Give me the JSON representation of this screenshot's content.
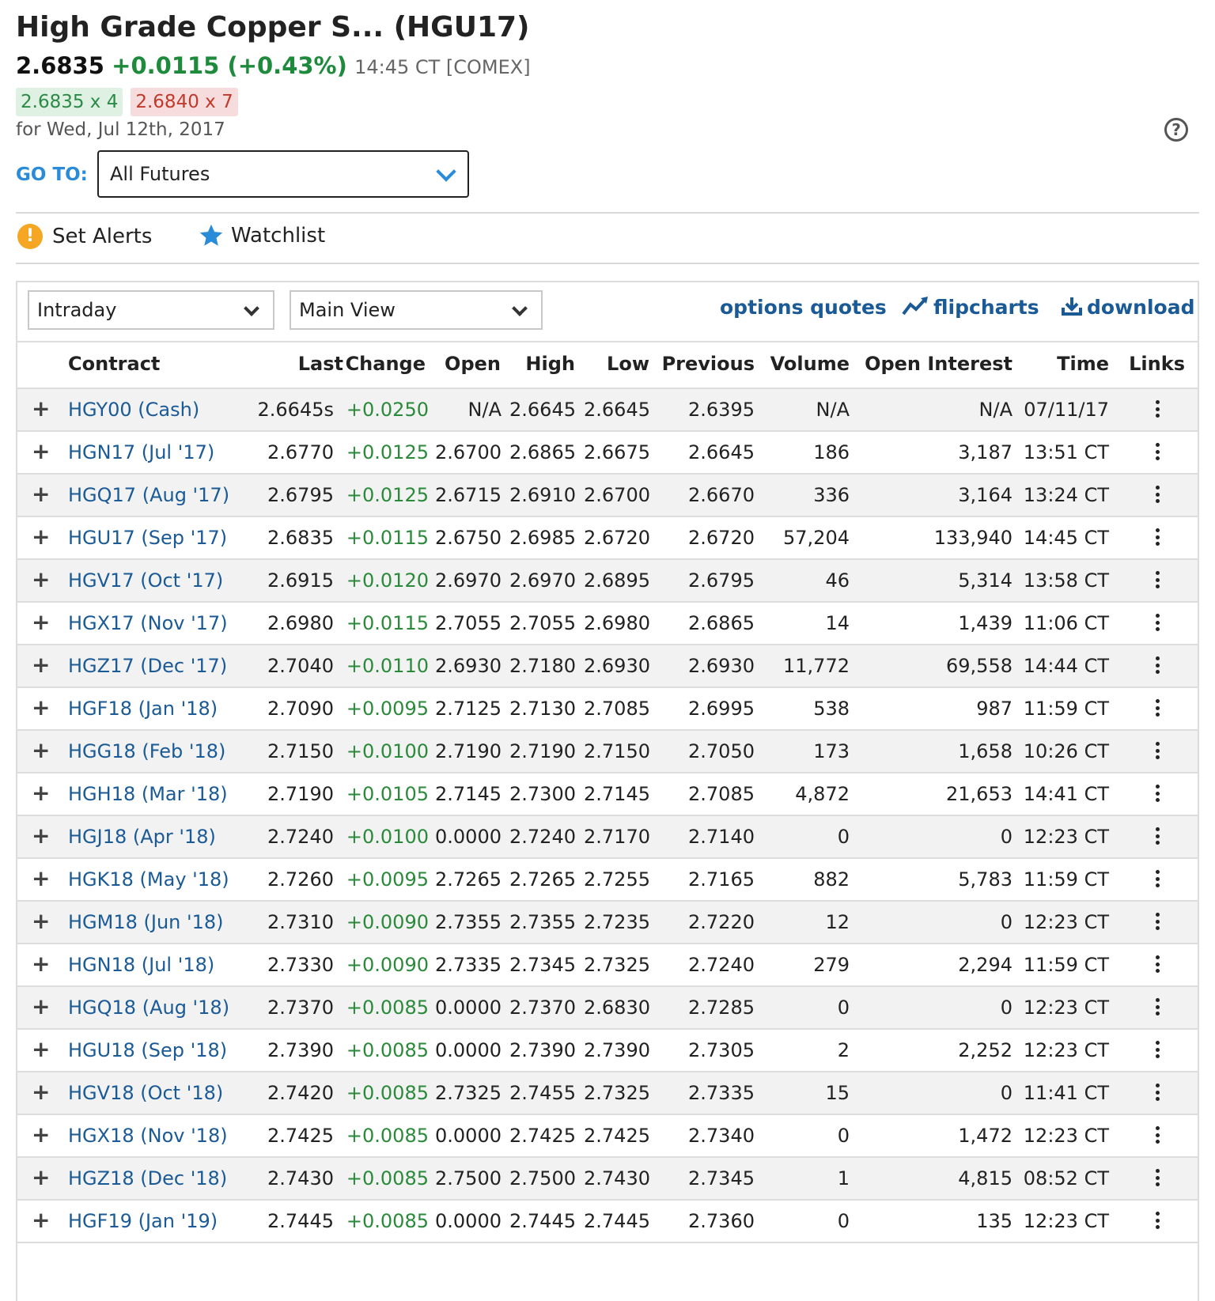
{
  "header": {
    "title": "High Grade Copper S...  (HGU17)",
    "last": "2.6835",
    "change": "+0.0115 (+0.43%)",
    "time_exchange": "14:45 CT [COMEX]",
    "bid": "2.6835 x 4",
    "ask": "2.6840 x 7",
    "for_date": "for Wed, Jul 12th, 2017",
    "help_glyph": "?"
  },
  "goto": {
    "label": "GO TO:",
    "value": "All Futures"
  },
  "actions": {
    "alerts_label": "Set Alerts",
    "alert_glyph": "!",
    "watchlist_label": "Watchlist"
  },
  "toolbar": {
    "period": "Intraday",
    "view": "Main View",
    "options_quotes": "options quotes",
    "flipcharts": "flipcharts",
    "download": "download"
  },
  "table": {
    "columns": [
      "Contract",
      "Last",
      "Change",
      "Open",
      "High",
      "Low",
      "Previous",
      "Volume",
      "Open Interest",
      "Time",
      "Links"
    ],
    "rows": [
      [
        "HGY00 (Cash)",
        "2.6645s",
        "+0.0250",
        "N/A",
        "2.6645",
        "2.6645",
        "2.6395",
        "N/A",
        "N/A",
        "07/11/17"
      ],
      [
        "HGN17 (Jul '17)",
        "2.6770",
        "+0.0125",
        "2.6700",
        "2.6865",
        "2.6675",
        "2.6645",
        "186",
        "3,187",
        "13:51 CT"
      ],
      [
        "HGQ17 (Aug '17)",
        "2.6795",
        "+0.0125",
        "2.6715",
        "2.6910",
        "2.6700",
        "2.6670",
        "336",
        "3,164",
        "13:24 CT"
      ],
      [
        "HGU17 (Sep '17)",
        "2.6835",
        "+0.0115",
        "2.6750",
        "2.6985",
        "2.6720",
        "2.6720",
        "57,204",
        "133,940",
        "14:45 CT"
      ],
      [
        "HGV17 (Oct '17)",
        "2.6915",
        "+0.0120",
        "2.6970",
        "2.6970",
        "2.6895",
        "2.6795",
        "46",
        "5,314",
        "13:58 CT"
      ],
      [
        "HGX17 (Nov '17)",
        "2.6980",
        "+0.0115",
        "2.7055",
        "2.7055",
        "2.6980",
        "2.6865",
        "14",
        "1,439",
        "11:06 CT"
      ],
      [
        "HGZ17 (Dec '17)",
        "2.7040",
        "+0.0110",
        "2.6930",
        "2.7180",
        "2.6930",
        "2.6930",
        "11,772",
        "69,558",
        "14:44 CT"
      ],
      [
        "HGF18 (Jan '18)",
        "2.7090",
        "+0.0095",
        "2.7125",
        "2.7130",
        "2.7085",
        "2.6995",
        "538",
        "987",
        "11:59 CT"
      ],
      [
        "HGG18 (Feb '18)",
        "2.7150",
        "+0.0100",
        "2.7190",
        "2.7190",
        "2.7150",
        "2.7050",
        "173",
        "1,658",
        "10:26 CT"
      ],
      [
        "HGH18 (Mar '18)",
        "2.7190",
        "+0.0105",
        "2.7145",
        "2.7300",
        "2.7145",
        "2.7085",
        "4,872",
        "21,653",
        "14:41 CT"
      ],
      [
        "HGJ18 (Apr '18)",
        "2.7240",
        "+0.0100",
        "0.0000",
        "2.7240",
        "2.7170",
        "2.7140",
        "0",
        "0",
        "12:23 CT"
      ],
      [
        "HGK18 (May '18)",
        "2.7260",
        "+0.0095",
        "2.7265",
        "2.7265",
        "2.7255",
        "2.7165",
        "882",
        "5,783",
        "11:59 CT"
      ],
      [
        "HGM18 (Jun '18)",
        "2.7310",
        "+0.0090",
        "2.7355",
        "2.7355",
        "2.7235",
        "2.7220",
        "12",
        "0",
        "12:23 CT"
      ],
      [
        "HGN18 (Jul '18)",
        "2.7330",
        "+0.0090",
        "2.7335",
        "2.7345",
        "2.7325",
        "2.7240",
        "279",
        "2,294",
        "11:59 CT"
      ],
      [
        "HGQ18 (Aug '18)",
        "2.7370",
        "+0.0085",
        "0.0000",
        "2.7370",
        "2.6830",
        "2.7285",
        "0",
        "0",
        "12:23 CT"
      ],
      [
        "HGU18 (Sep '18)",
        "2.7390",
        "+0.0085",
        "0.0000",
        "2.7390",
        "2.7390",
        "2.7305",
        "2",
        "2,252",
        "12:23 CT"
      ],
      [
        "HGV18 (Oct '18)",
        "2.7420",
        "+0.0085",
        "2.7325",
        "2.7455",
        "2.7325",
        "2.7335",
        "15",
        "0",
        "11:41 CT"
      ],
      [
        "HGX18 (Nov '18)",
        "2.7425",
        "+0.0085",
        "0.0000",
        "2.7425",
        "2.7425",
        "2.7340",
        "0",
        "1,472",
        "12:23 CT"
      ],
      [
        "HGZ18 (Dec '18)",
        "2.7430",
        "+0.0085",
        "2.7500",
        "2.7500",
        "2.7430",
        "2.7345",
        "1",
        "4,815",
        "08:52 CT"
      ],
      [
        "HGF19 (Jan '19)",
        "2.7445",
        "+0.0085",
        "0.0000",
        "2.7445",
        "2.7445",
        "2.7360",
        "0",
        "135",
        "12:23 CT"
      ]
    ]
  },
  "colors": {
    "positive": "#2a8a3a",
    "link": "#1a5a96",
    "accent": "#2a8cd8",
    "alert": "#f5a623"
  },
  "icons": {
    "alert": "exclamation-circle-icon",
    "watchlist": "star-icon",
    "flipcharts": "trend-chart-icon",
    "download": "download-icon",
    "links": "kebab-menu-icon",
    "expand": "plus-icon",
    "help": "question-circle-icon"
  }
}
